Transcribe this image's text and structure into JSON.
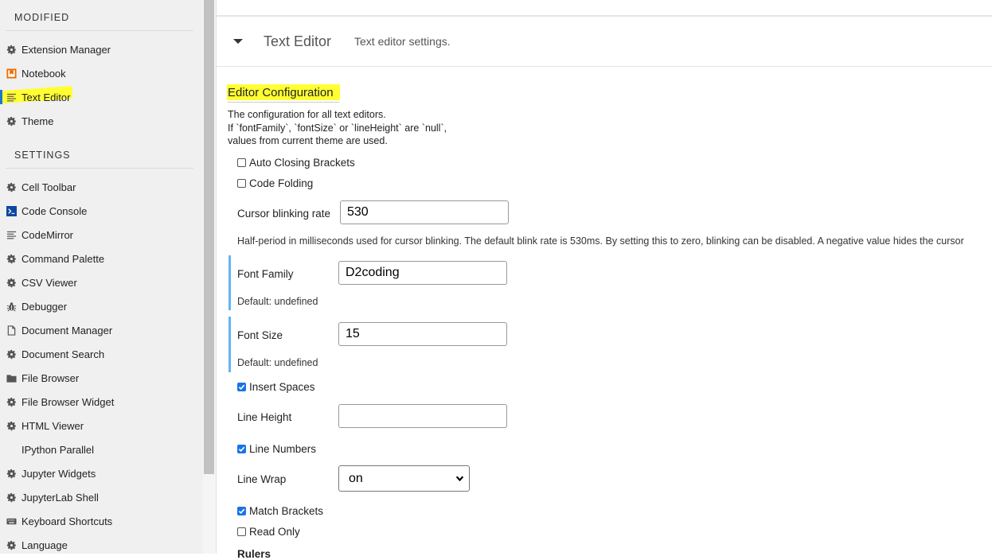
{
  "sidebar": {
    "modified_heading": "MODIFIED",
    "settings_heading": "SETTINGS",
    "modified_items": [
      {
        "label": "Extension Manager",
        "icon": "gear-icon"
      },
      {
        "label": "Notebook",
        "icon": "notebook-icon"
      },
      {
        "label": "Text Editor",
        "icon": "text-editor-icon"
      },
      {
        "label": "Theme",
        "icon": "gear-icon"
      }
    ],
    "settings_items": [
      {
        "label": "Cell Toolbar",
        "icon": "gear-icon"
      },
      {
        "label": "Code Console",
        "icon": "console-icon"
      },
      {
        "label": "CodeMirror",
        "icon": "text-editor-icon"
      },
      {
        "label": "Command Palette",
        "icon": "gear-icon"
      },
      {
        "label": "CSV Viewer",
        "icon": "gear-icon"
      },
      {
        "label": "Debugger",
        "icon": "bug-icon"
      },
      {
        "label": "Document Manager",
        "icon": "file-icon"
      },
      {
        "label": "Document Search",
        "icon": "gear-icon"
      },
      {
        "label": "File Browser",
        "icon": "folder-icon"
      },
      {
        "label": "File Browser Widget",
        "icon": "gear-icon"
      },
      {
        "label": "HTML Viewer",
        "icon": "gear-icon"
      },
      {
        "label": "IPython Parallel",
        "icon": ""
      },
      {
        "label": "Jupyter Widgets",
        "icon": "gear-icon"
      },
      {
        "label": "JupyterLab Shell",
        "icon": "gear-icon"
      },
      {
        "label": "Keyboard Shortcuts",
        "icon": "keyboard-icon"
      },
      {
        "label": "Language",
        "icon": "gear-icon"
      }
    ]
  },
  "panel": {
    "title": "Text Editor",
    "description": "Text editor settings."
  },
  "config": {
    "title": "Editor Configuration",
    "description_lines": [
      "The configuration for all text editors.",
      "If `fontFamily`, `fontSize` or `lineHeight` are `null`,",
      "values from current theme are used."
    ],
    "auto_closing_brackets": {
      "label": "Auto Closing Brackets",
      "checked": false
    },
    "code_folding": {
      "label": "Code Folding",
      "checked": false
    },
    "cursor_blink_rate": {
      "label": "Cursor blinking rate",
      "value": "530",
      "help": "Half-period in milliseconds used for cursor blinking. The default blink rate is 530ms. By setting this to zero, blinking can be disabled. A negative value hides the cursor"
    },
    "font_family": {
      "label": "Font Family",
      "value": "D2coding",
      "default_text": "Default: undefined"
    },
    "font_size": {
      "label": "Font Size",
      "value": "15",
      "default_text": "Default: undefined"
    },
    "insert_spaces": {
      "label": "Insert Spaces",
      "checked": true
    },
    "line_height": {
      "label": "Line Height",
      "value": ""
    },
    "line_numbers": {
      "label": "Line Numbers",
      "checked": true
    },
    "line_wrap": {
      "label": "Line Wrap",
      "value": "on"
    },
    "match_brackets": {
      "label": "Match Brackets",
      "checked": true
    },
    "read_only": {
      "label": "Read Only",
      "checked": false
    },
    "rulers_label": "Rulers"
  },
  "colors": {
    "accent": "#1a73e8",
    "highlight": "#ffff33",
    "modified_bar": "#64b5f6"
  }
}
